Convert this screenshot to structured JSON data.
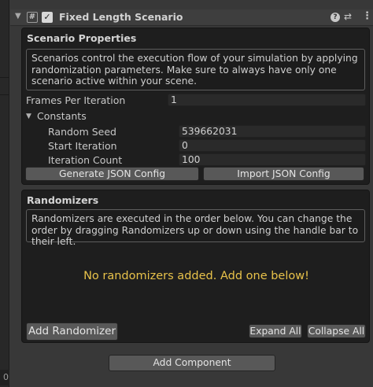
{
  "left_strip": {
    "zero_label": "0"
  },
  "header": {
    "fold_icon": "triangle-down-icon",
    "script_icon_glyph": "#",
    "check_glyph": "✓",
    "title": "Fixed Length Scenario",
    "help_glyph": "?",
    "preset_glyph": "⇄",
    "menu_glyph": "⋮"
  },
  "scenario": {
    "title": "Scenario Properties",
    "help_text": "Scenarios control the execution flow of your simulation by applying randomization parameters. Make sure to always have only one scenario active within your scene.",
    "frames_label": "Frames Per Iteration",
    "frames_value": "1",
    "constants_label": "Constants",
    "random_seed_label": "Random Seed",
    "random_seed_value": "539662031",
    "start_iteration_label": "Start Iteration",
    "start_iteration_value": "0",
    "iteration_count_label": "Iteration Count",
    "iteration_count_value": "100",
    "generate_button": "Generate JSON Config",
    "import_button": "Import JSON Config"
  },
  "randomizers": {
    "title": "Randomizers",
    "help_text": "Randomizers are executed in the order below. You can change the order by dragging Randomizers up or down using the handle bar to their left.",
    "empty_message": "No randomizers added. Add one below!",
    "add_button": "Add Randomizer",
    "expand_button": "Expand All",
    "collapse_button": "Collapse All"
  },
  "footer": {
    "add_component_button": "Add Component"
  },
  "colors": {
    "empty_message": "#e8c24a",
    "panel_background": "#1e1e1e",
    "inspector_background": "#383838"
  }
}
